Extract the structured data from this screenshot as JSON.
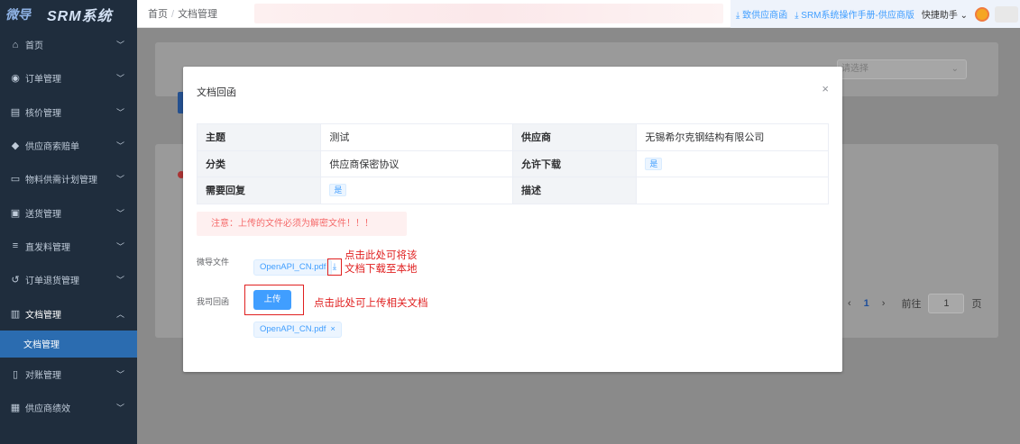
{
  "sidebar": {
    "brand": "微导",
    "system": "SRM系统",
    "items": [
      {
        "icon": "home-icon",
        "glyph": "⌂",
        "label": "首页"
      },
      {
        "icon": "check-circle-icon",
        "glyph": "◉",
        "label": "订单管理"
      },
      {
        "icon": "document-icon",
        "glyph": "▤",
        "label": "核价管理"
      },
      {
        "icon": "shield-icon",
        "glyph": "◆",
        "label": "供应商索赔单"
      },
      {
        "icon": "monitor-icon",
        "glyph": "▭",
        "label": "物料供需计划管理"
      },
      {
        "icon": "package-icon",
        "glyph": "▣",
        "label": "送货管理"
      },
      {
        "icon": "sliders-icon",
        "glyph": "≡",
        "label": "直发料管理"
      },
      {
        "icon": "return-icon",
        "glyph": "↺",
        "label": "订单退货管理"
      },
      {
        "icon": "file-icon",
        "glyph": "▥",
        "label": "文档管理"
      }
    ],
    "active_sub": "文档管理",
    "items_after": [
      {
        "icon": "ledger-icon",
        "glyph": "▯",
        "label": "对账管理"
      },
      {
        "icon": "chart-icon",
        "glyph": "▦",
        "label": "供应商绩效"
      }
    ]
  },
  "header": {
    "crumb_home": "首页",
    "crumb_sep": "/",
    "crumb_current": "文档管理",
    "link1": "⤓ 致供应商函",
    "link2": "⤓ SRM系统操作手册-供应商版",
    "helper": "快捷助手 ⌄"
  },
  "background": {
    "select_placeholder": "请选择",
    "pager_prev": "‹",
    "pager_page": "1",
    "pager_next": "›",
    "pager_goto": "前往",
    "pager_input": "1",
    "pager_unit": "页"
  },
  "modal": {
    "title": "文档回函",
    "close": "×",
    "fields": {
      "subject_key": "主题",
      "subject_val": "测试",
      "supplier_key": "供应商",
      "supplier_val": "无锡希尔克钢结构有限公司",
      "category_key": "分类",
      "category_val": "供应商保密协议",
      "download_key": "允许下载",
      "download_val": "是",
      "reply_key": "需要回复",
      "reply_val": "是",
      "desc_key": "描述",
      "desc_val": ""
    },
    "warning": "注意：上传的文件必须为解密文件！！！",
    "file_label": "微导文件",
    "file_name": "OpenAPI_CN.pdf",
    "download_glyph": "⤓",
    "download_note_1": "点击此处可将该",
    "download_note_2": "文档下载至本地",
    "reply_label": "我司回函",
    "upload_label": "上传",
    "upload_note": "点击此处可上传相关文档",
    "uploaded_file": "OpenAPI_CN.pdf",
    "remove_glyph": "×"
  }
}
